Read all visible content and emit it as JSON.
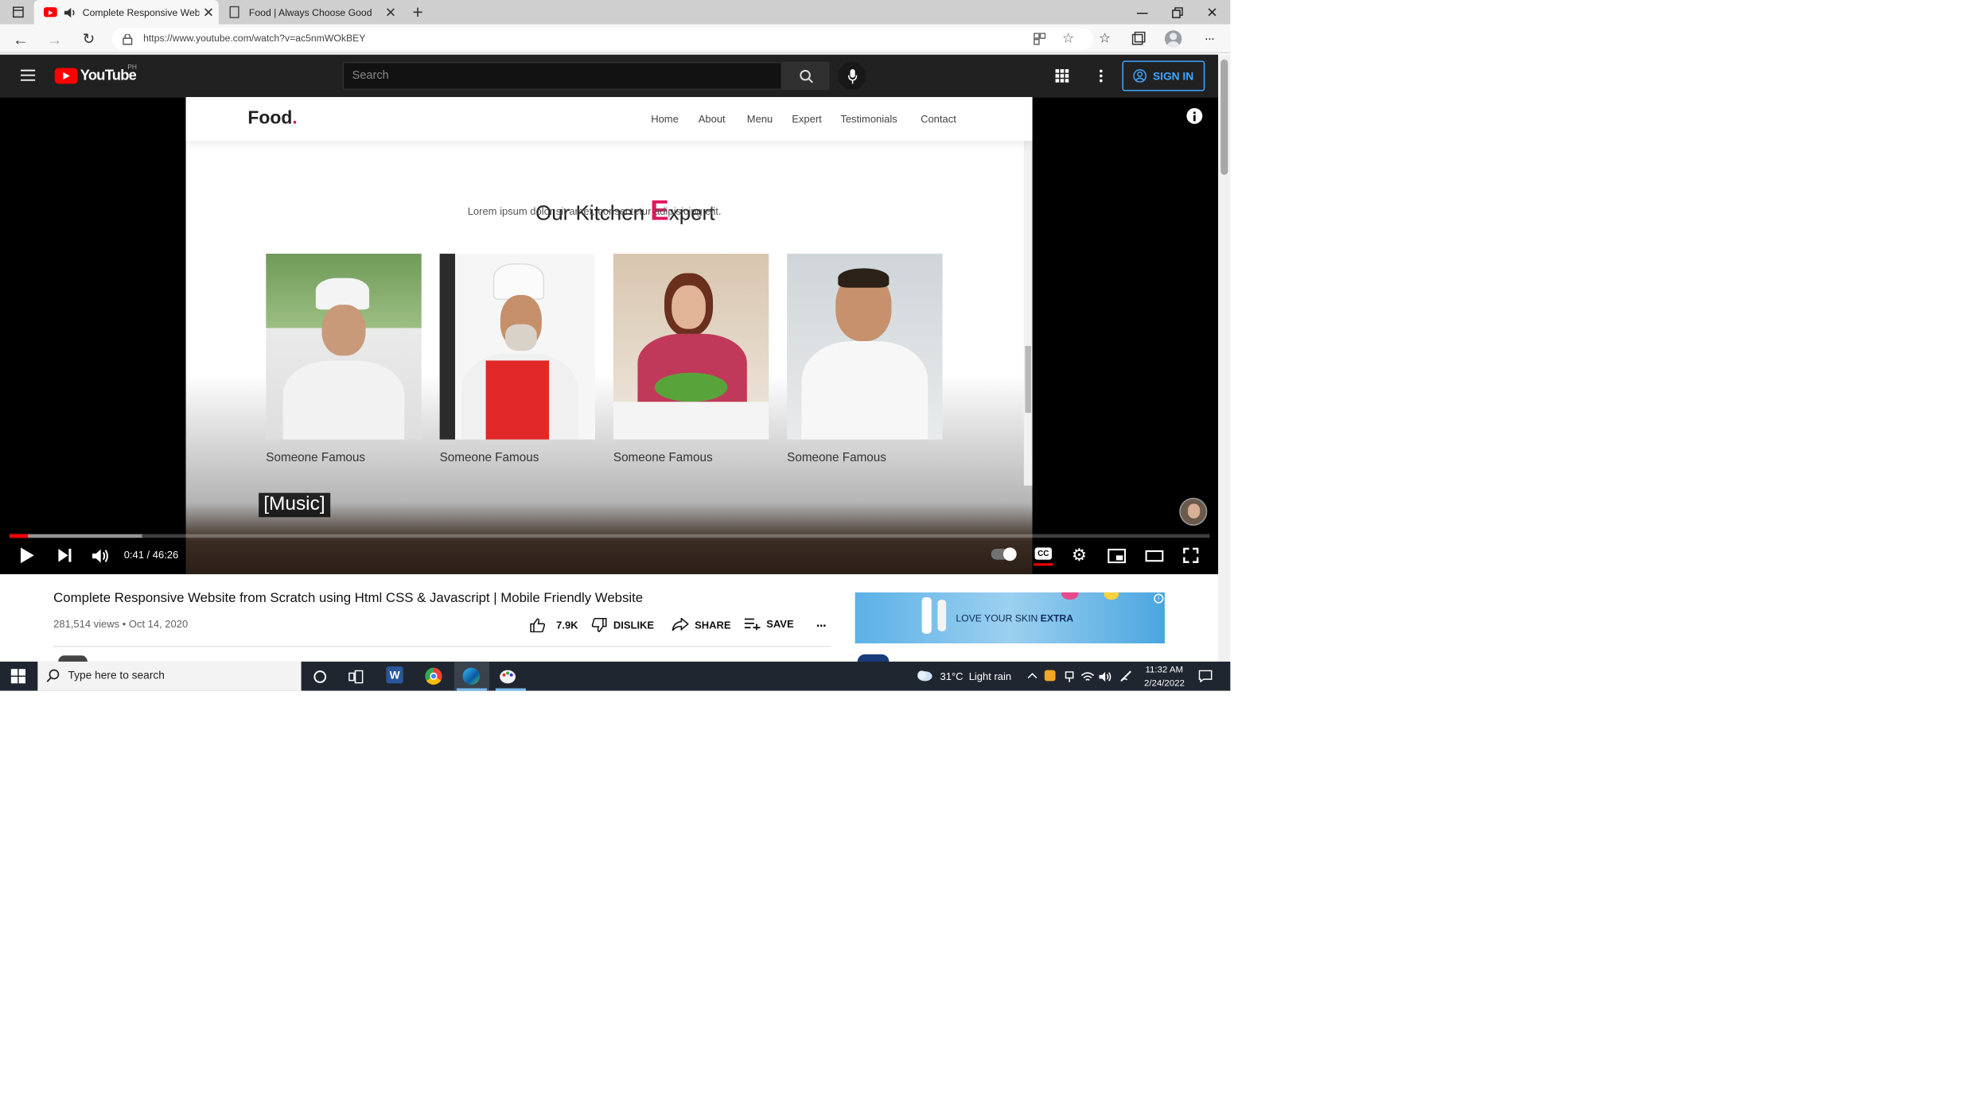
{
  "browser": {
    "tabs": [
      {
        "title": "Complete Responsive Website",
        "active": true
      },
      {
        "title": "Food | Always Choose Good",
        "active": false
      }
    ],
    "url": "https://www.youtube.com/watch?v=ac5nmWOkBEY"
  },
  "youtube": {
    "logo_text": "YouTube",
    "region": "PH",
    "search_placeholder": "Search",
    "signin_label": "SIGN IN"
  },
  "video_frame": {
    "brand": "Food",
    "brand_dot": ".",
    "nav": [
      "Home",
      "About",
      "Menu",
      "Expert",
      "Testimonials",
      "Contact"
    ],
    "heading_before": "Our Kitchen ",
    "heading_accent": "E",
    "heading_after": "xpert",
    "subheading": "Lorem ipsum dolor sit amet, consectetur adipisicing elit.",
    "experts": [
      "Someone Famous",
      "Someone Famous",
      "Someone Famous",
      "Someone Famous"
    ],
    "caption": "[Music]"
  },
  "player": {
    "time": "0:41 / 46:26",
    "progress_played_fraction": 0.015,
    "buffered_fraction": 0.11
  },
  "video_info": {
    "title": "Complete Responsive Website from Scratch using Html CSS & Javascript | Mobile Friendly Website",
    "meta": "281,514 views • Oct 14, 2020",
    "likes": "7.9K",
    "dislike": "DISLIKE",
    "share": "SHARE",
    "save": "SAVE"
  },
  "ad": {
    "text_before": "LOVE YOUR SKIN ",
    "text_bold": "EXTRA"
  },
  "taskbar": {
    "search_placeholder": "Type here to search",
    "weather": "31°C  Light rain",
    "time": "11:32 AM",
    "date": "2/24/2022"
  },
  "colors": {
    "accent": "#e0155d",
    "yt_red": "#ff0000",
    "signin_blue": "#3ea6ff"
  }
}
